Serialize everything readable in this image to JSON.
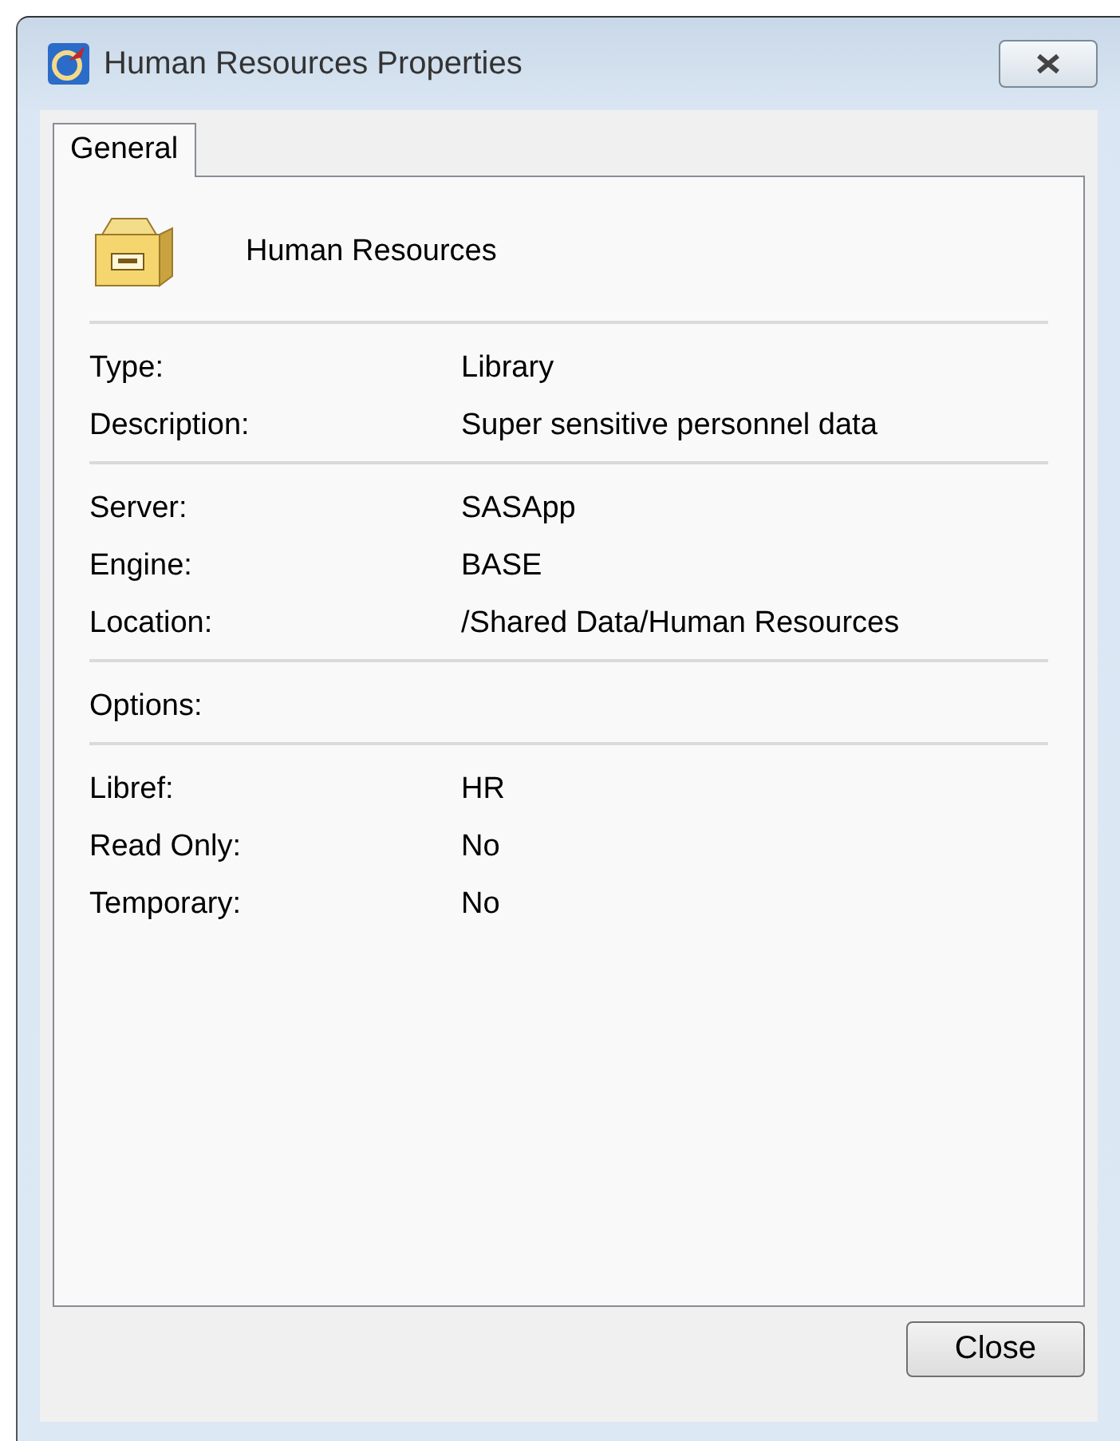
{
  "window": {
    "title": "Human Resources Properties"
  },
  "tabs": [
    {
      "label": "General",
      "selected": true
    }
  ],
  "header": {
    "name": "Human Resources"
  },
  "sections": [
    {
      "rows": [
        {
          "label": "Type:",
          "value": "Library"
        },
        {
          "label": "Description:",
          "value": "Super sensitive personnel data"
        }
      ]
    },
    {
      "rows": [
        {
          "label": "Server:",
          "value": "SASApp"
        },
        {
          "label": "Engine:",
          "value": "BASE"
        },
        {
          "label": "Location:",
          "value": "/Shared Data/Human Resources"
        }
      ]
    },
    {
      "rows": [
        {
          "label": "Options:"
        }
      ]
    },
    {
      "rows": [
        {
          "label": "Libref:",
          "value": "HR"
        },
        {
          "label": "Read Only:",
          "value": "No"
        },
        {
          "label": "Temporary:",
          "value": "No"
        }
      ]
    }
  ],
  "buttons": [
    {
      "label": "Close"
    }
  ]
}
